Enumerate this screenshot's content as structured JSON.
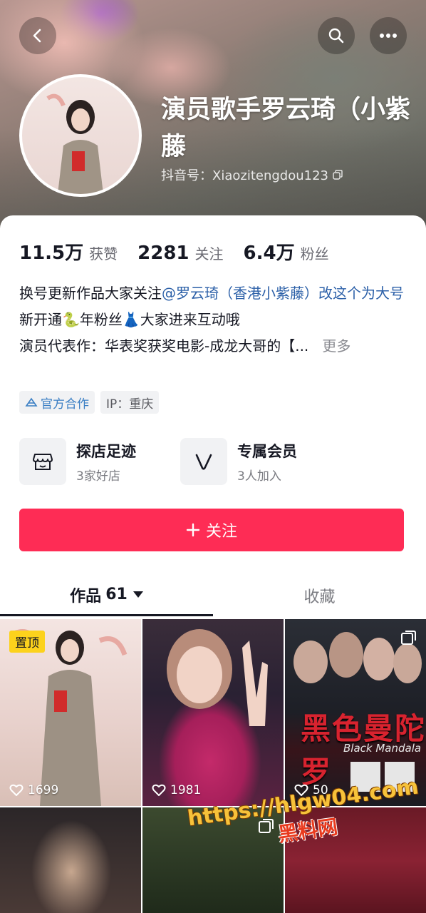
{
  "header": {
    "name": "演员歌手罗云琦（小紫藤",
    "douyin_id": "抖音号：Xiaozitengdou123"
  },
  "stats": [
    {
      "num": "11.5万",
      "label": "获赞"
    },
    {
      "num": "2281",
      "label": "关注"
    },
    {
      "num": "6.4万",
      "label": "粉丝"
    }
  ],
  "bio": {
    "line1_pre": "换号更新作品大家关注",
    "line1_mention": "@罗云琦（香港小紫藤）改这个为大号",
    "line2": "新开通🐍年粉丝👗大家进来互动哦",
    "line3": "演员代表作：华表奖获奖电影-成龙大哥的【...",
    "more": "更多"
  },
  "tags": [
    {
      "label": "官方合作",
      "icon": "official-icon"
    },
    {
      "label": "IP：重庆"
    }
  ],
  "features": [
    {
      "title": "探店足迹",
      "sub": "3家好店",
      "icon": "store-icon"
    },
    {
      "title": "专属会员",
      "sub": "3人加入",
      "icon": "membership-icon"
    }
  ],
  "follow_label": "关注",
  "tabs": [
    {
      "label": "作品",
      "count": "61",
      "active": true
    },
    {
      "label": "收藏",
      "active": false
    }
  ],
  "grid": [
    {
      "pinned": "置顶",
      "likes": "1699"
    },
    {
      "likes": "1981"
    },
    {
      "likes": "50",
      "title": "黑色曼陀罗",
      "subtitle": "Black Mandala"
    },
    {},
    {},
    {}
  ],
  "watermark": {
    "url": "https://hlgw04.com",
    "text": "黑料网"
  },
  "colors": {
    "accent": "#fe2c55",
    "mention": "#2c60a8",
    "pin": "#fcd21c"
  }
}
